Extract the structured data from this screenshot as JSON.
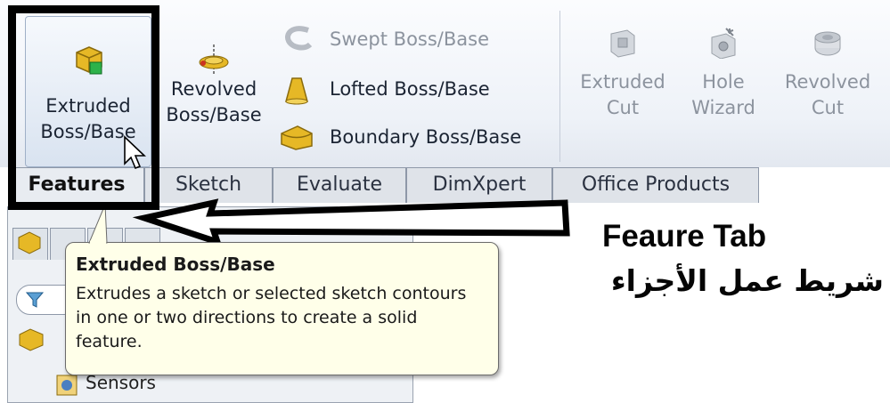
{
  "ribbon": {
    "extruded_boss": {
      "line1": "Extruded",
      "line2": "Boss/Base"
    },
    "revolved_boss": {
      "line1": "Revolved",
      "line2": "Boss/Base"
    },
    "swept_boss": "Swept Boss/Base",
    "lofted_boss": "Lofted Boss/Base",
    "boundary_boss": "Boundary Boss/Base",
    "extruded_cut": {
      "line1": "Extruded",
      "line2": "Cut"
    },
    "hole_wizard": {
      "line1": "Hole",
      "line2": "Wizard"
    },
    "revolved_cut": {
      "line1": "Revolved",
      "line2": "Cut"
    }
  },
  "tabs": [
    "Features",
    "Sketch",
    "Evaluate",
    "DimXpert",
    "Office Products"
  ],
  "tooltip": {
    "title": "Extruded Boss/Base",
    "body": "Extrudes a sketch or selected sketch contours in one or two directions to create a solid feature."
  },
  "tree": {
    "sensors": "Sensors"
  },
  "callout": {
    "english": "Feaure Tab",
    "arabic": "شريط عمل الأجزاء"
  },
  "colors": {
    "highlight": "#000000",
    "tooltip_bg": "#ffffe9",
    "disabled_text": "#8c939e"
  }
}
